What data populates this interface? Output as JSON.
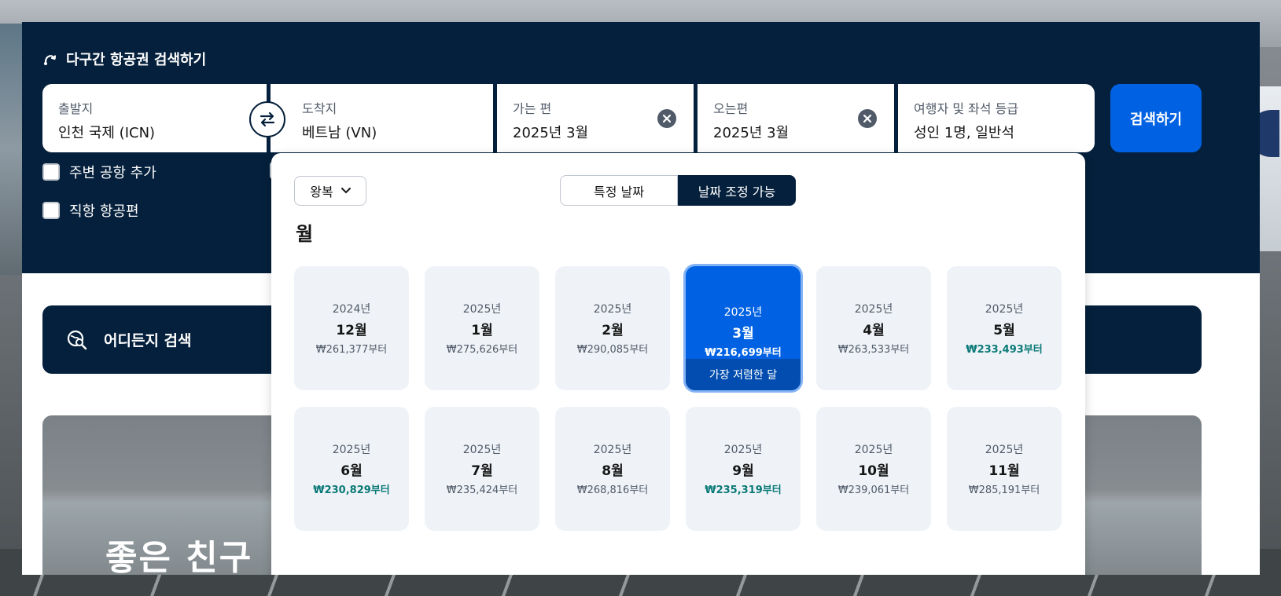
{
  "panel": {
    "title": "다구간 항공권 검색하기"
  },
  "origin": {
    "label": "출발지",
    "value": "인천 국제 (ICN)"
  },
  "destination": {
    "label": "도착지",
    "value": "베트남 (VN)"
  },
  "depart": {
    "label": "가는 편",
    "value": "2025년 3월"
  },
  "return": {
    "label": "오는편",
    "value": "2025년 3월"
  },
  "travellers": {
    "label": "여행자 및 좌석 등급",
    "value": "성인 1명, 일반석"
  },
  "search_button": "검색하기",
  "options": {
    "nearby": "주변 공항 추가",
    "direct": "직항 항공편"
  },
  "explore": "어디든지 검색",
  "hero_text": "좋은 친구",
  "popup": {
    "trip_type": "왕복",
    "toggle_specific": "특정 날짜",
    "toggle_flexible": "날짜 조정 가능",
    "heading": "월",
    "cheapest_badge": "가장 저렴한 달",
    "months": [
      {
        "year": "2024년",
        "month": "12월",
        "price": "₩261,377부터",
        "low": false,
        "selected": false
      },
      {
        "year": "2025년",
        "month": "1월",
        "price": "₩275,626부터",
        "low": false,
        "selected": false
      },
      {
        "year": "2025년",
        "month": "2월",
        "price": "₩290,085부터",
        "low": false,
        "selected": false
      },
      {
        "year": "2025년",
        "month": "3월",
        "price": "₩216,699부터",
        "low": false,
        "selected": true
      },
      {
        "year": "2025년",
        "month": "4월",
        "price": "₩263,533부터",
        "low": false,
        "selected": false
      },
      {
        "year": "2025년",
        "month": "5월",
        "price": "₩233,493부터",
        "low": true,
        "selected": false
      },
      {
        "year": "2025년",
        "month": "6월",
        "price": "₩230,829부터",
        "low": true,
        "selected": false
      },
      {
        "year": "2025년",
        "month": "7월",
        "price": "₩235,424부터",
        "low": false,
        "selected": false
      },
      {
        "year": "2025년",
        "month": "8월",
        "price": "₩268,816부터",
        "low": false,
        "selected": false
      },
      {
        "year": "2025년",
        "month": "9월",
        "price": "₩235,319부터",
        "low": true,
        "selected": false
      },
      {
        "year": "2025년",
        "month": "10월",
        "price": "₩239,061부터",
        "low": false,
        "selected": false
      },
      {
        "year": "2025년",
        "month": "11월",
        "price": "₩285,191부터",
        "low": false,
        "selected": false
      }
    ]
  },
  "colors": {
    "navy": "#05203c",
    "primary": "#0062e3",
    "low_price": "#0b7a77",
    "cell_bg": "#eff3f8"
  }
}
